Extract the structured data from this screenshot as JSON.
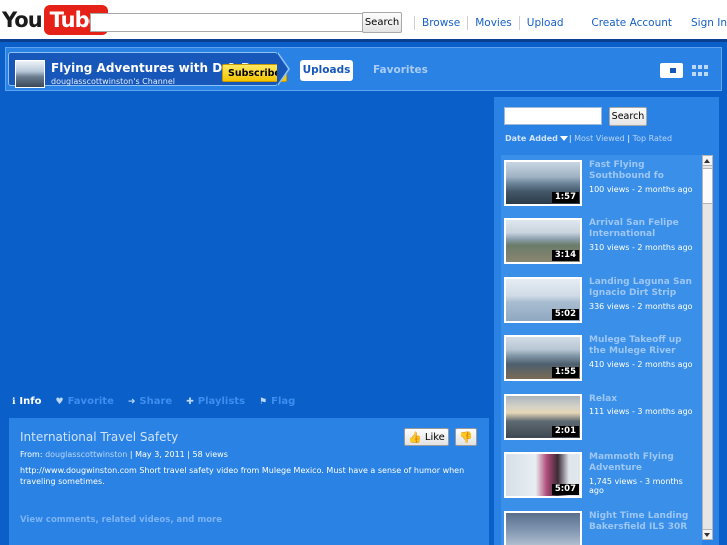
{
  "header": {
    "logo_you": "You",
    "logo_tube": "Tube",
    "search_button": "Search",
    "search_value": "",
    "nav": [
      "Browse",
      "Movies",
      "Upload"
    ],
    "create_account": "Create Account",
    "sign_in": "Sign In"
  },
  "channel": {
    "title": "Flying Adventures with D & D",
    "subtitle": "douglasscottwinston's Channel",
    "subscribe": "Subscribe",
    "tab_uploads": "Uploads",
    "tab_favorites": "Favorites"
  },
  "actions": {
    "info": "Info",
    "favorite": "Favorite",
    "share": "Share",
    "playlists": "Playlists",
    "flag": "Flag"
  },
  "video": {
    "title": "International Travel Safety",
    "like": "Like",
    "from_label": "From:",
    "author": "douglasscottwinston",
    "date": "May 3, 2011",
    "views": "58 views",
    "description": "http://www.dougwinston.com Short travel safety video from Mulege Mexico. Must have a sense of humor when traveling sometimes.",
    "more_link": "View comments, related videos, and more"
  },
  "sidebar": {
    "search_button": "Search",
    "search_value": "",
    "sort": {
      "date_added": "Date Added",
      "most_viewed": "Most Viewed",
      "top_rated": "Top Rated"
    },
    "videos": [
      {
        "title": "Fast Flying Southbound fo",
        "views": "100 views - 2 months ago",
        "duration": "1:57"
      },
      {
        "title": "Arrival San Felipe International",
        "views": "310 views - 2 months ago",
        "duration": "3:14"
      },
      {
        "title": "Landing Laguna San Ignacio Dirt Strip",
        "views": "336 views - 2 months ago",
        "duration": "5:02"
      },
      {
        "title": "Mulege Takeoff up the Mulege River",
        "views": "410 views - 2 months ago",
        "duration": "1:55"
      },
      {
        "title": "Relax",
        "views": "111 views - 3 months ago",
        "duration": "2:01"
      },
      {
        "title": "Mammoth Flying Adventure",
        "views": "1,745 views - 3 months ago",
        "duration": "5:07"
      },
      {
        "title": "Night Time Landing Bakersfield ILS 30R",
        "views": "",
        "duration": ""
      }
    ]
  },
  "colors": {
    "page_bg": "#0a5fc8",
    "panel_bg": "#2a82e4",
    "subscribe_bg": "#f5c400",
    "logo_red": "#e62117"
  },
  "icons": {
    "info": "info-icon",
    "favorite": "heart-icon",
    "share": "arrow-right-icon",
    "playlists": "plus-icon",
    "flag": "flag-icon"
  }
}
